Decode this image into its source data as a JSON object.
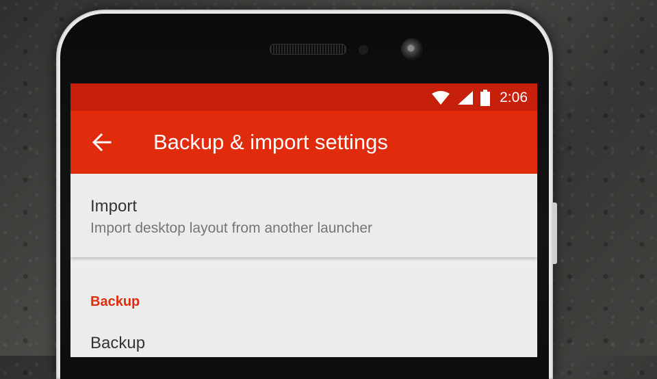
{
  "status_bar": {
    "time": "2:06",
    "icons": [
      "wifi-icon",
      "cell-signal-icon",
      "battery-icon"
    ]
  },
  "toolbar": {
    "back_icon": "arrow-back-icon",
    "title": "Backup & import settings"
  },
  "preferences": {
    "import": {
      "title": "Import",
      "summary": "Import desktop layout from another launcher"
    },
    "backup_section": {
      "header": "Backup",
      "item_title": "Backup"
    }
  },
  "colors": {
    "status_bar": "#c61f0a",
    "toolbar": "#e02b0c",
    "accent": "#e02b0c",
    "background": "#eeeeee"
  }
}
